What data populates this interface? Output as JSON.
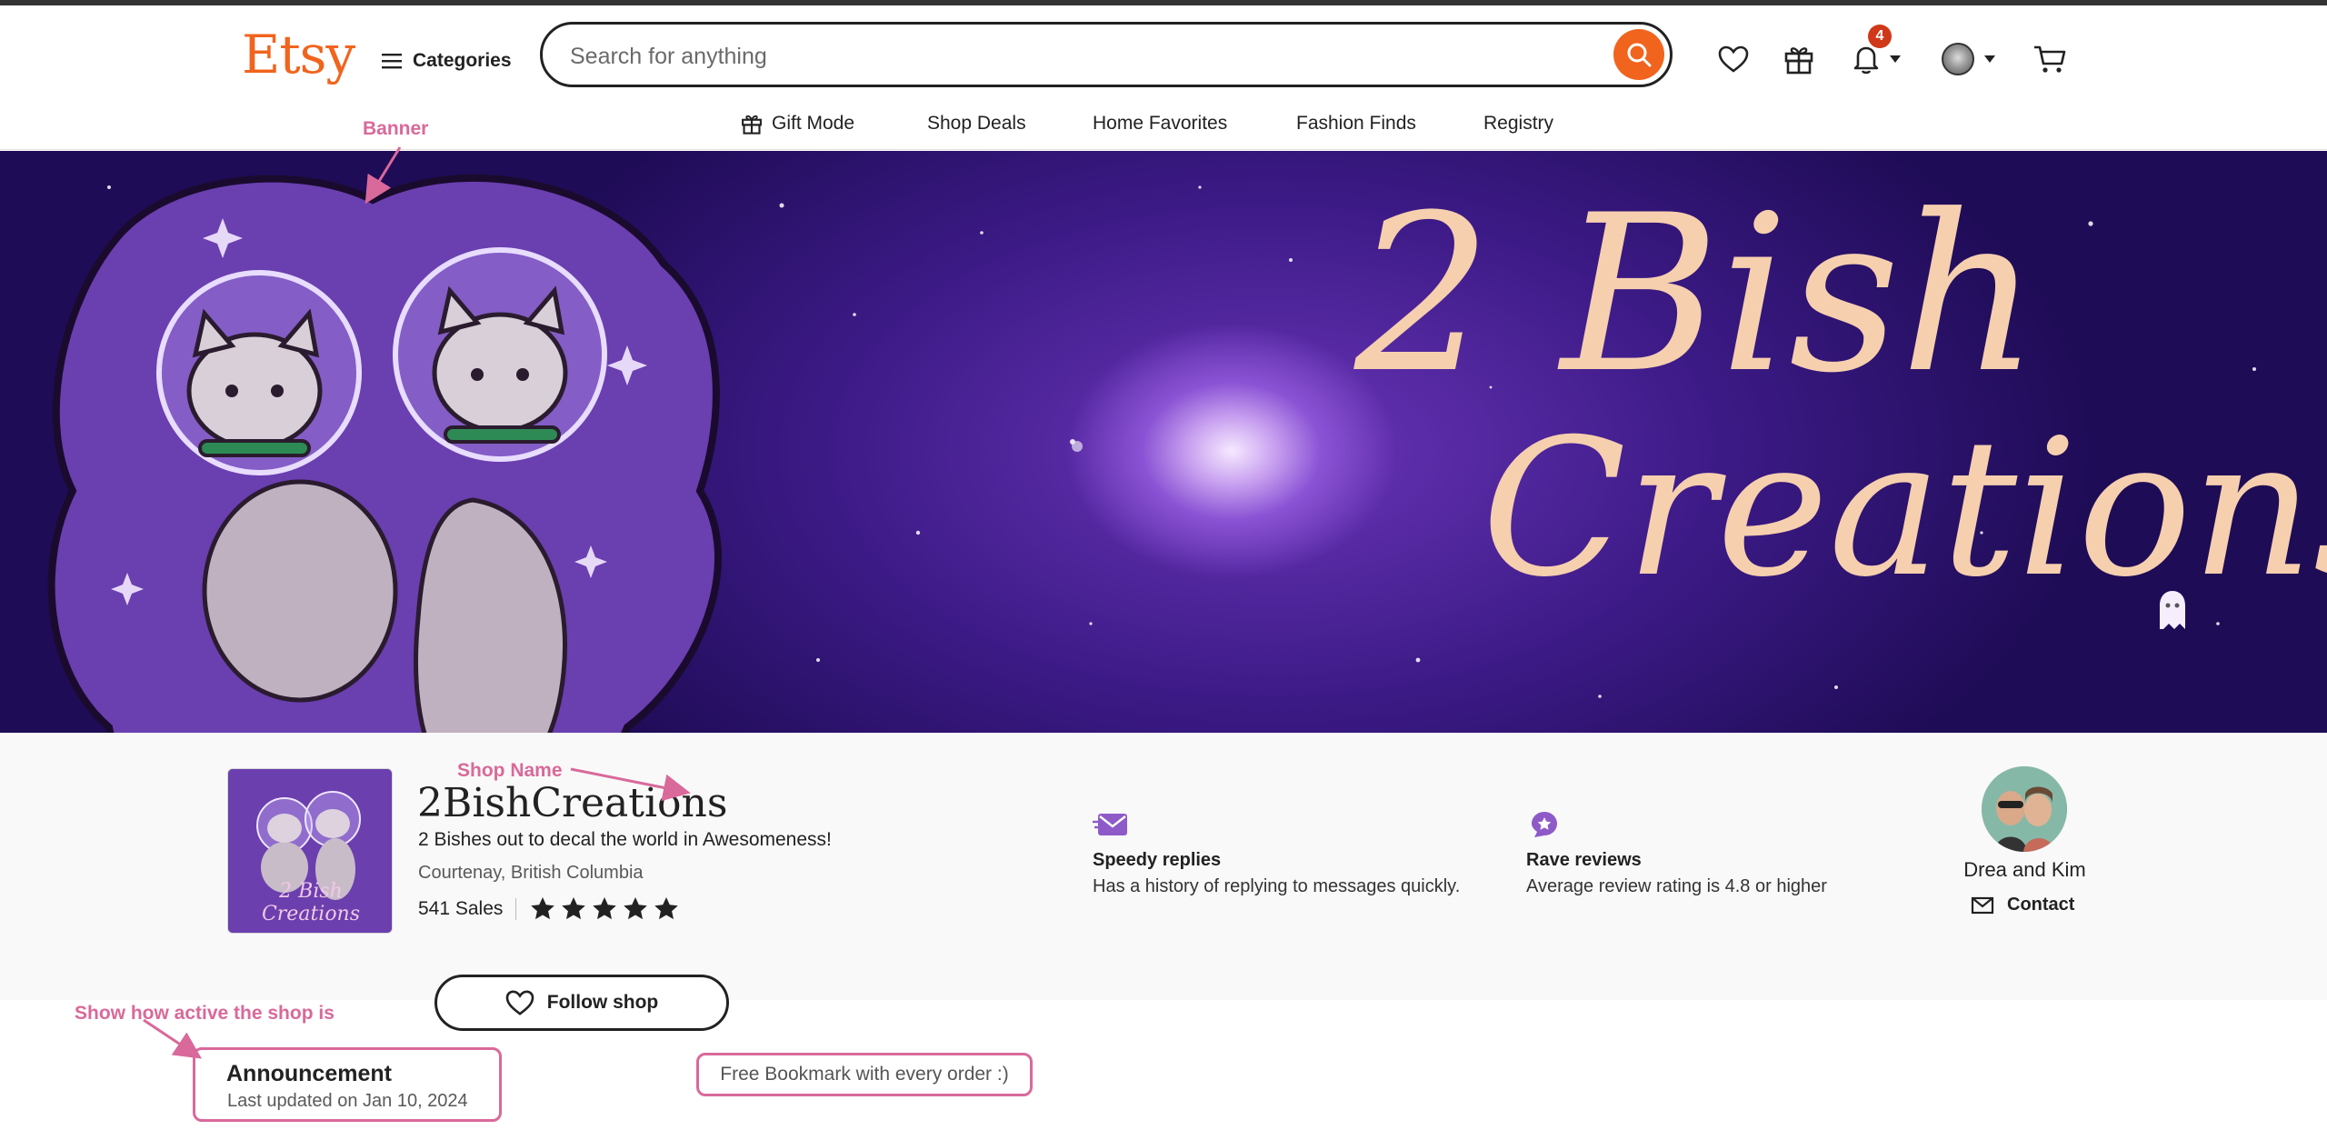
{
  "header": {
    "logo": "Etsy",
    "categories_label": "Categories",
    "search_placeholder": "Search for anything",
    "notification_count": "4",
    "accent_color": "#f1641e"
  },
  "subnav": {
    "items": [
      "Gift Mode",
      "Shop Deals",
      "Home Favorites",
      "Fashion Finds",
      "Registry"
    ]
  },
  "banner": {
    "title_line1": "2 Bish",
    "title_line2": "Creations"
  },
  "shop": {
    "name": "2BishCreations",
    "tagline": "2 Bishes out to decal the world in Awesomeness!",
    "location": "Courtenay, British Columbia",
    "sales": "541 Sales",
    "rating_stars": 5,
    "logo_text": "2 Bish Creations",
    "follow_label": "Follow shop"
  },
  "features": [
    {
      "title": "Speedy replies",
      "desc": "Has a history of replying to messages quickly.",
      "icon": "envelope-speed-icon"
    },
    {
      "title": "Rave reviews",
      "desc": "Average review rating is 4.8 or higher",
      "icon": "star-badge-icon"
    }
  ],
  "owner": {
    "name": "Drea and Kim",
    "contact_label": "Contact"
  },
  "announcement": {
    "title": "Announcement",
    "updated": "Last updated on Jan 10, 2024",
    "message": "Free Bookmark with every order :)"
  },
  "annotations": {
    "banner": "Banner",
    "shop_name": "Shop Name",
    "activity": "Show how active the shop is",
    "color": "#d9699a"
  }
}
